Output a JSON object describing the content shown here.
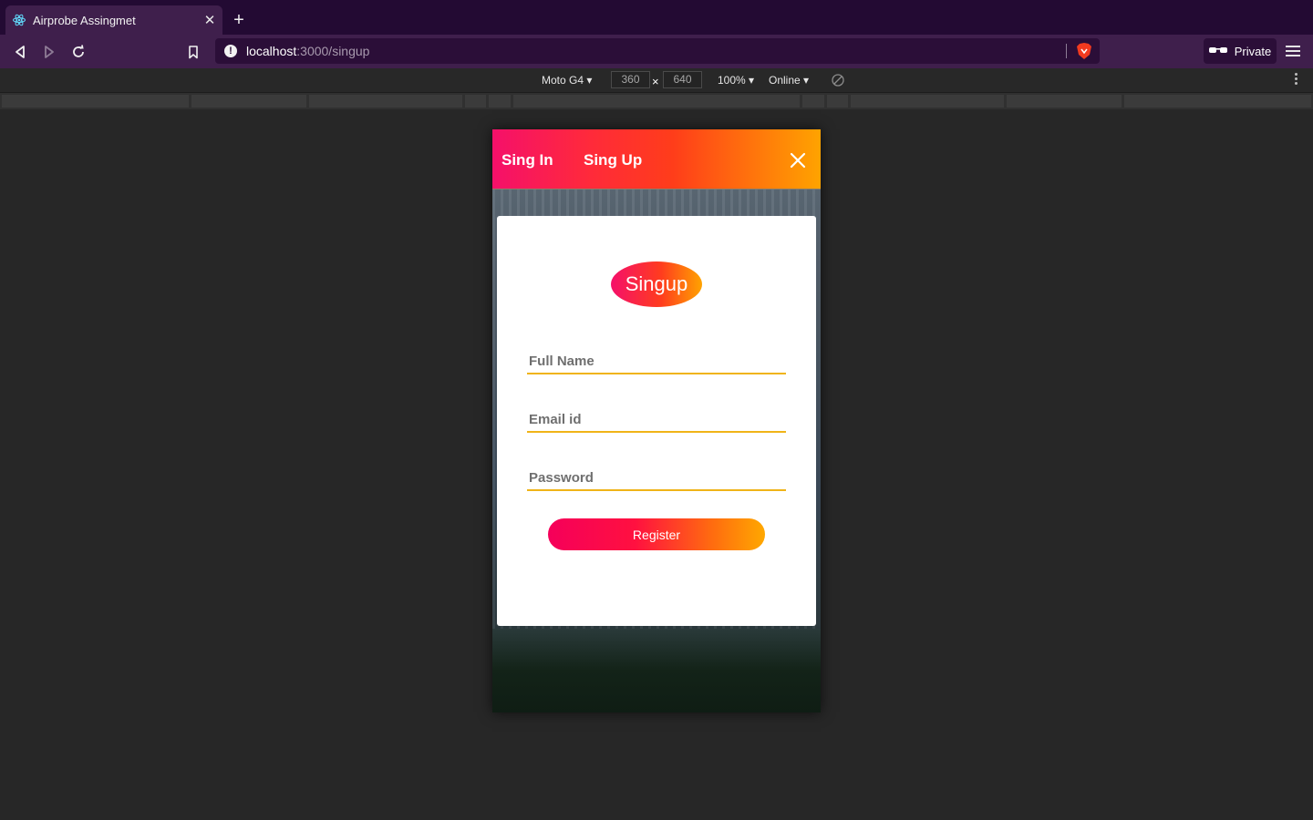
{
  "browser": {
    "tab_title": "Airprobe Assingmet",
    "url_host": "localhost",
    "url_path": ":3000/singup",
    "private_label": "Private"
  },
  "devtools": {
    "device": "Moto G4",
    "width": "360",
    "height": "640",
    "zoom": "100%",
    "network": "Online"
  },
  "app": {
    "nav": {
      "signin_label": "Sing In",
      "signup_label": "Sing Up"
    },
    "form": {
      "title": "Singup",
      "fullname_placeholder": "Full Name",
      "email_placeholder": "Email id",
      "password_placeholder": "Password",
      "register_label": "Register"
    }
  },
  "colors": {
    "gradient_start": "#f5106a",
    "gradient_end": "#ffa300",
    "field_underline": "#f0b418",
    "browser_chrome": "#3f1f4c"
  }
}
